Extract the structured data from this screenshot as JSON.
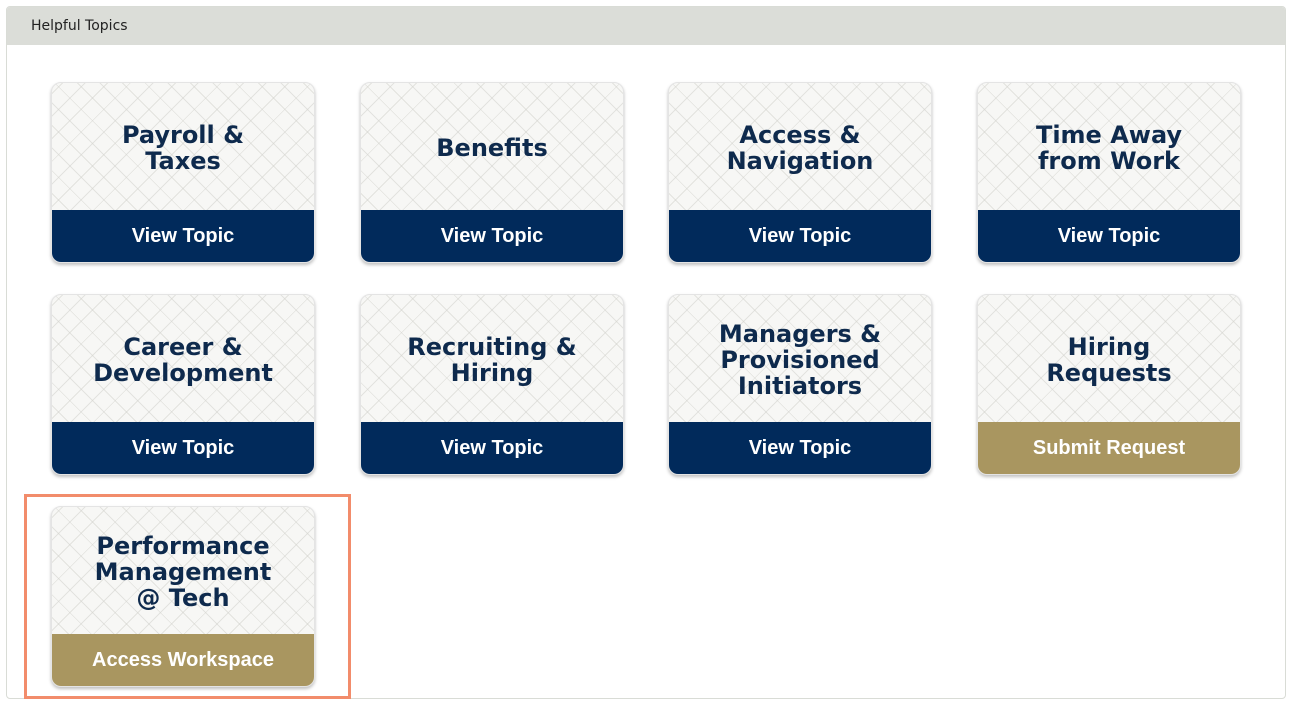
{
  "panel": {
    "title": "Helpful Topics"
  },
  "cards": [
    {
      "title": "Payroll &\nTaxes",
      "button": "View Topic",
      "button_style": "navy"
    },
    {
      "title": "Benefits",
      "button": "View Topic",
      "button_style": "navy"
    },
    {
      "title": "Access &\nNavigation",
      "button": "View Topic",
      "button_style": "navy"
    },
    {
      "title": "Time Away\nfrom Work",
      "button": "View Topic",
      "button_style": "navy"
    },
    {
      "title": "Career &\nDevelopment",
      "button": "View Topic",
      "button_style": "navy"
    },
    {
      "title": "Recruiting &\nHiring",
      "button": "View Topic",
      "button_style": "navy"
    },
    {
      "title": "Managers &\nProvisioned\nInitiators",
      "button": "View Topic",
      "button_style": "navy"
    },
    {
      "title": "Hiring\nRequests",
      "button": "Submit Request",
      "button_style": "gold"
    },
    {
      "title": "Performance\nManagement\n@ Tech",
      "button": "Access Workspace",
      "button_style": "gold"
    }
  ],
  "colors": {
    "navy": "#012a5b",
    "gold": "#a99660",
    "title_text": "#0e2a4d",
    "highlight": "#f28c6b"
  }
}
